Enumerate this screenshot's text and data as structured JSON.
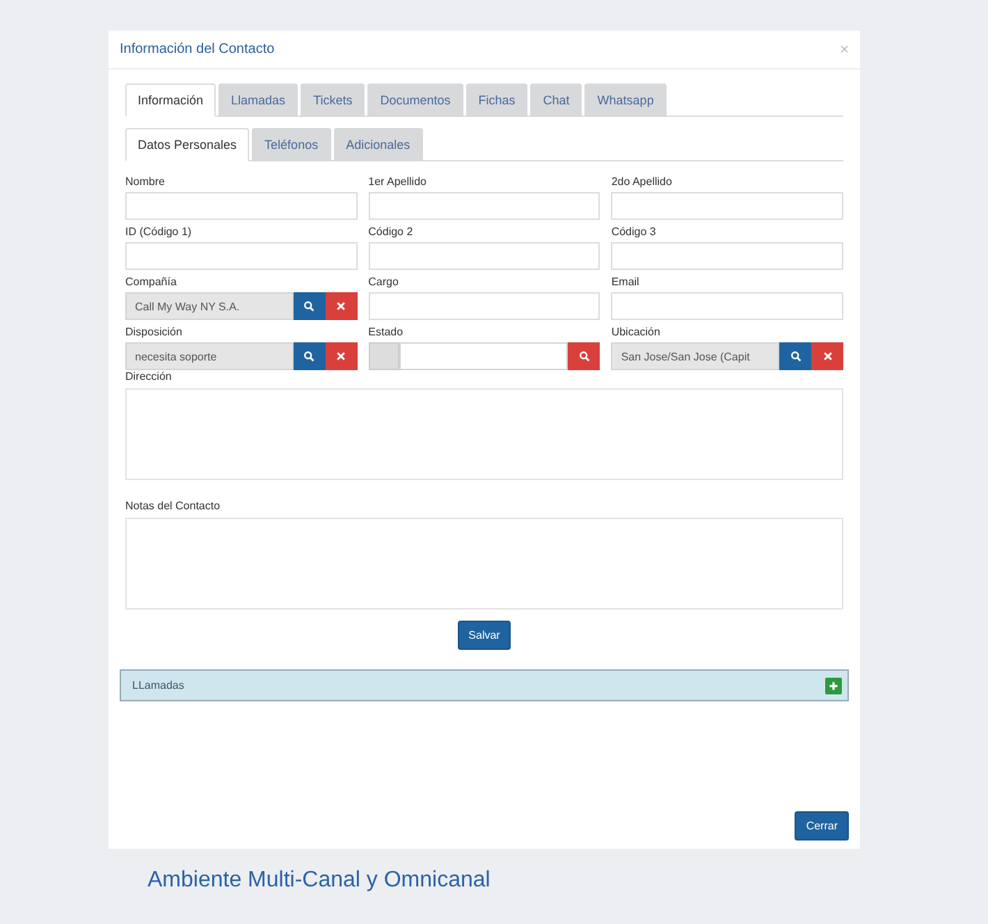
{
  "caption": "Ambiente Multi-Canal y Omnicanal",
  "modal": {
    "title": "Información del Contacto",
    "close": "×",
    "tabs": [
      {
        "label": "Información",
        "selected": true
      },
      {
        "label": "Llamadas",
        "selected": false
      },
      {
        "label": "Tickets",
        "selected": false
      },
      {
        "label": "Documentos",
        "selected": false
      },
      {
        "label": "Fichas",
        "selected": false
      },
      {
        "label": "Chat",
        "selected": false
      },
      {
        "label": "Whatsapp",
        "selected": false
      }
    ],
    "subtabs": [
      {
        "label": "Datos Personales",
        "selected": true
      },
      {
        "label": "Teléfonos",
        "selected": false
      },
      {
        "label": "Adicionales",
        "selected": false
      }
    ],
    "fields": [
      {
        "kind": "text",
        "label": "Nombre"
      },
      {
        "kind": "text",
        "label": "1er Apellido"
      },
      {
        "kind": "text",
        "label": "2do Apellido"
      },
      {
        "kind": "text",
        "label": "ID (Código 1)"
      },
      {
        "kind": "text",
        "label": "Código 2"
      },
      {
        "kind": "text",
        "label": "Código 3"
      },
      {
        "kind": "lookup",
        "label": "Compañía",
        "value": "Call My Way NY S.A."
      },
      {
        "kind": "text",
        "label": "Cargo"
      },
      {
        "kind": "text",
        "label": "Email"
      },
      {
        "kind": "lookup",
        "label": "Disposición",
        "value": "necesita soporte"
      },
      {
        "kind": "status",
        "label": "Estado"
      },
      {
        "kind": "lookup",
        "label": "Ubicación",
        "value": "San Jose/San Jose (Capit"
      }
    ],
    "textareas": [
      {
        "label": "Dirección"
      },
      {
        "label": "Notas del Contacto"
      }
    ],
    "save": "Salvar",
    "panel": {
      "title": "LLamadas"
    },
    "footer_button": "Cerrar"
  }
}
